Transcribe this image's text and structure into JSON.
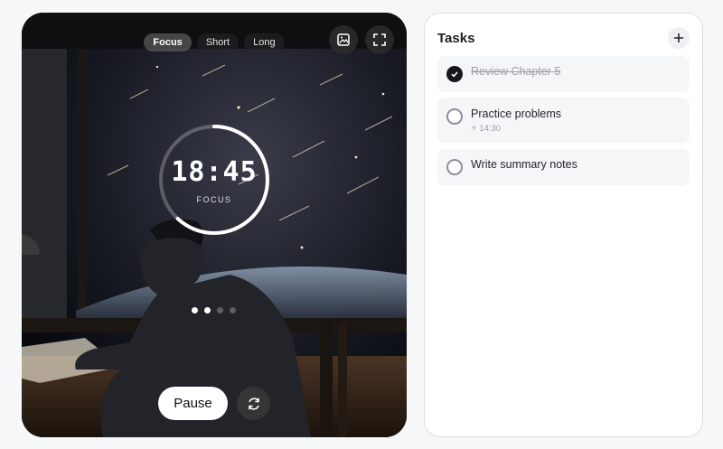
{
  "timer": {
    "modes": [
      {
        "label": "Focus",
        "active": true
      },
      {
        "label": "Short",
        "active": false
      },
      {
        "label": "Long",
        "active": false
      }
    ],
    "time": "18:45",
    "mode_label": "FOCUS",
    "progress": 0.62,
    "pause_label": "Pause",
    "dots": [
      true,
      true,
      false,
      false
    ],
    "icons": {
      "image": "image-icon",
      "fullscreen": "fullscreen-icon",
      "reset": "reset-icon"
    }
  },
  "tasks": {
    "title": "Tasks",
    "add_icon": "plus-icon",
    "items": [
      {
        "label": "Review Chapter 5",
        "done": true,
        "meta": ""
      },
      {
        "label": "Practice problems",
        "done": false,
        "meta": "14:30"
      },
      {
        "label": "Write summary notes",
        "done": false,
        "meta": ""
      }
    ]
  },
  "colors": {
    "accent": "#15181d",
    "ring": "#ffffff",
    "card_bg": "#0b0e16"
  }
}
